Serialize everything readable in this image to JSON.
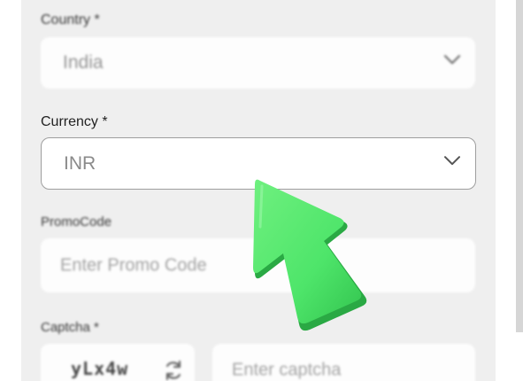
{
  "form": {
    "country": {
      "label": "Country *",
      "value": "India"
    },
    "currency": {
      "label": "Currency *",
      "value": "INR"
    },
    "promo": {
      "label": "PromoCode",
      "placeholder": "Enter Promo Code"
    },
    "captcha": {
      "label": "Captcha *",
      "image_text": "yLx4w",
      "placeholder": "Enter captcha"
    }
  },
  "icons": {
    "dropdown": "chevron-down-icon",
    "refresh": "refresh-icon",
    "pointer": "arrow-pointer-icon"
  },
  "colors": {
    "panel_bg": "#efefef",
    "arrow_green": "#4ee56a"
  }
}
